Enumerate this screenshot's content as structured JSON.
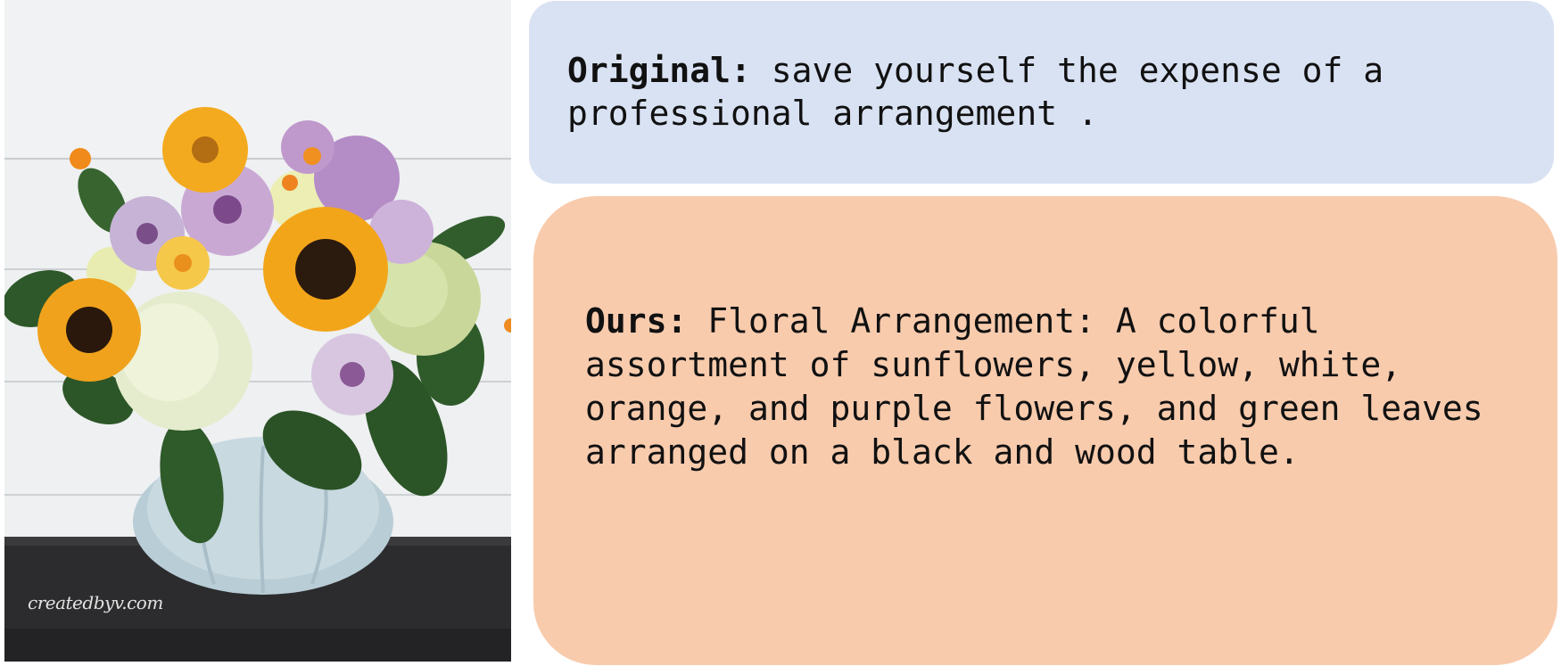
{
  "image": {
    "subject": "flower-arrangement-photo",
    "watermark": "createdbyv.com"
  },
  "original": {
    "label": "Original:",
    "text": " save yourself the expense of a professional arrangement ."
  },
  "ours": {
    "label": "Ours:",
    "text": " Floral Arrangement: A colorful assortment of sunflowers, yellow, white, orange, and purple flowers, and green leaves arranged on a black and wood table."
  },
  "colors": {
    "original_box": "#d9e2f3",
    "ours_box": "#f8cbad"
  }
}
